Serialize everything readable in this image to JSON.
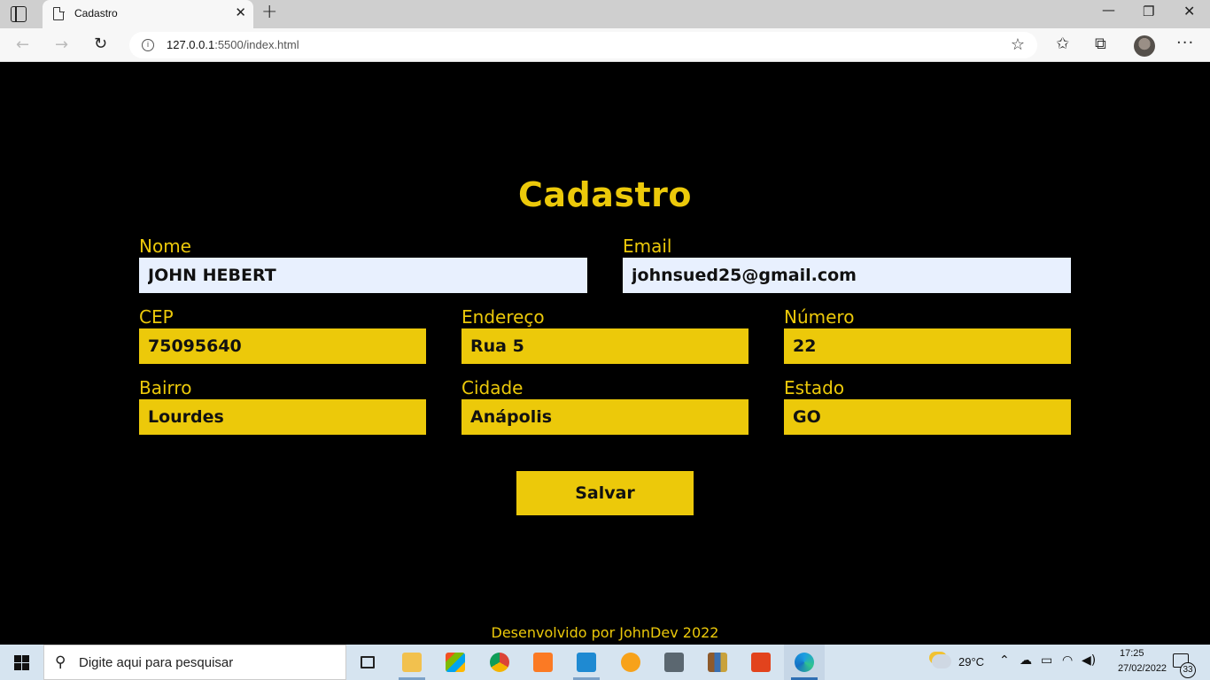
{
  "browser": {
    "tab_title": "Cadastro",
    "tab_close": "✕",
    "new_tab": "+",
    "url_host": "127.0.0.1",
    "url_rest": ":5500/index.html",
    "icons": [
      "tab-actions-icon",
      "page-icon",
      "back-icon",
      "forward-icon",
      "reload-icon",
      "info-icon",
      "add-favorite-icon",
      "favorites-icon",
      "collections-icon",
      "profile-avatar",
      "more-icon"
    ],
    "window_controls": {
      "minimize": "—",
      "maximize": "❐",
      "close": "✕"
    }
  },
  "page": {
    "title": "Cadastro",
    "fields": {
      "nome": {
        "label": "Nome",
        "value": "JOHN HEBERT"
      },
      "email": {
        "label": "Email",
        "value": "johnsued25@gmail.com"
      },
      "cep": {
        "label": "CEP",
        "value": "75095640"
      },
      "endereco": {
        "label": "Endereço",
        "value": "Rua 5"
      },
      "numero": {
        "label": "Número",
        "value": "22"
      },
      "bairro": {
        "label": "Bairro",
        "value": "Lourdes"
      },
      "cidade": {
        "label": "Cidade",
        "value": "Anápolis"
      },
      "estado": {
        "label": "Estado",
        "value": "GO"
      }
    },
    "save_label": "Salvar",
    "footer": "Desenvolvido por JohnDev 2022",
    "colors": {
      "accent": "#ecc90a",
      "background": "#000000",
      "autofill": "#e8f0fe"
    }
  },
  "taskbar": {
    "search_placeholder": "Digite aqui para pesquisar",
    "apps": [
      "task-view",
      "file-explorer",
      "microsoft-store",
      "chrome",
      "xampp",
      "vscode",
      "scratch",
      "remote-desktop",
      "library",
      "office",
      "edge"
    ],
    "weather_temp": "29°C",
    "time": "17:25",
    "date": "27/02/2022",
    "notification_count": "33"
  }
}
